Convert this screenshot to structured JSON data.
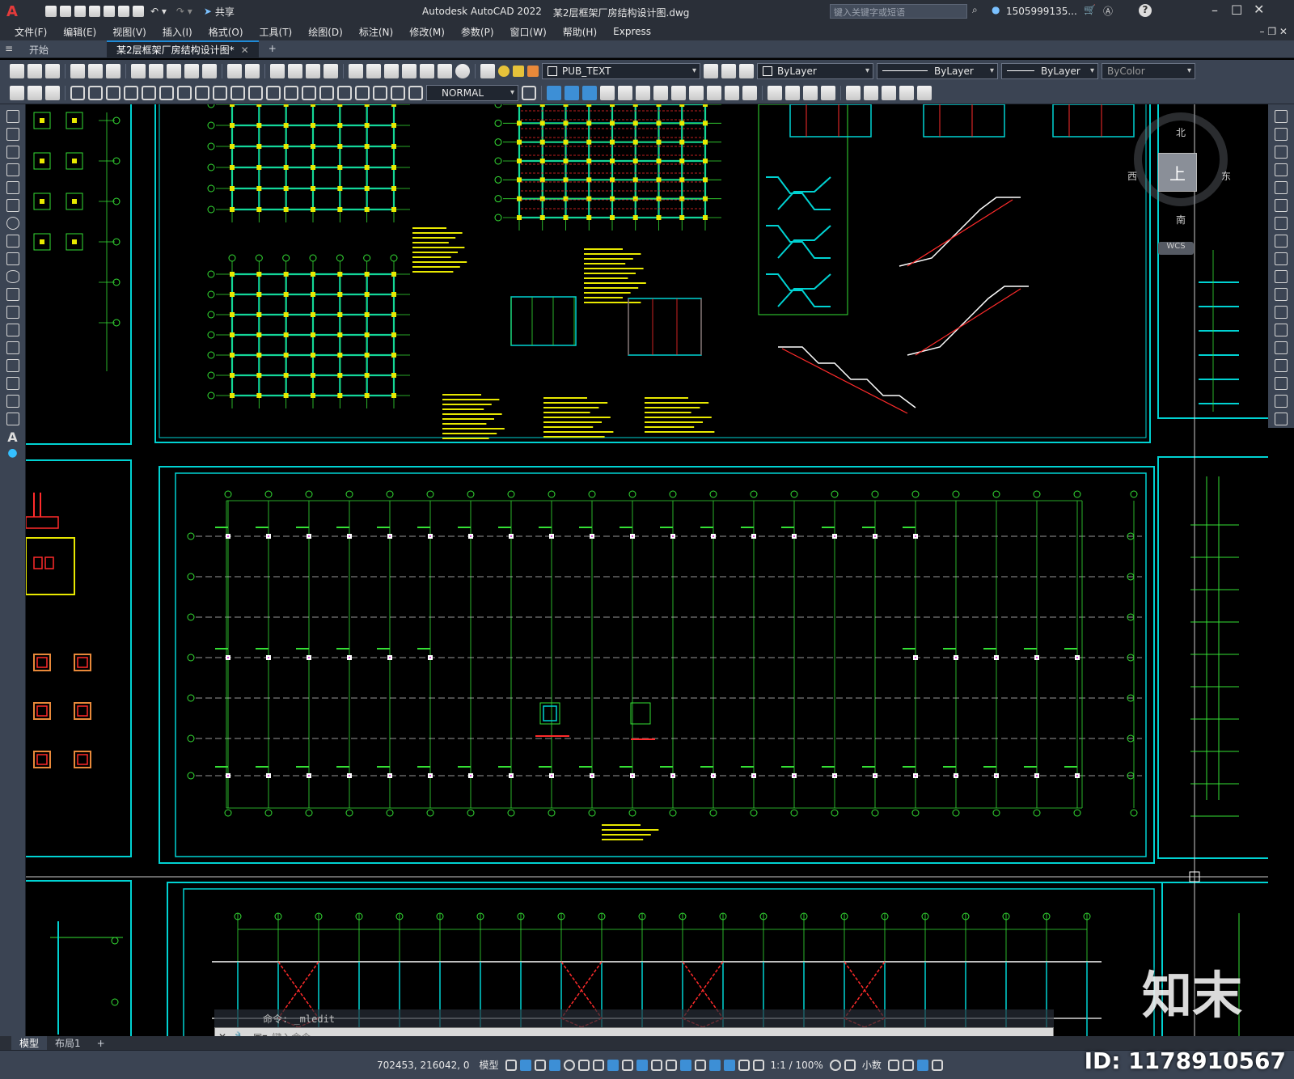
{
  "app": {
    "logo_letter": "A",
    "title": "Autodesk AutoCAD 2022",
    "filename": "某2层框架厂房结构设计图.dwg",
    "share_label": "共享",
    "search_placeholder": "键入关键字或短语",
    "user_name": "1505999135...",
    "help_label": "?"
  },
  "menu": {
    "items": [
      "文件(F)",
      "编辑(E)",
      "视图(V)",
      "插入(I)",
      "格式(O)",
      "工具(T)",
      "绘图(D)",
      "标注(N)",
      "修改(M)",
      "参数(P)",
      "窗口(W)",
      "帮助(H)",
      "Express"
    ]
  },
  "tabs": {
    "start": "开始",
    "active": "某2层框架厂房结构设计图*",
    "add": "+"
  },
  "toolbar": {
    "layer_name": "PUB_TEXT",
    "color": "ByLayer",
    "linetype": "ByLayer",
    "lineweight": "ByLayer",
    "plotstyle": "ByColor",
    "dimstyle": "NORMAL"
  },
  "viewcube": {
    "north": "北",
    "south": "南",
    "east": "东",
    "west": "西",
    "top": "上",
    "wcs": "WCS"
  },
  "command": {
    "history": "命令: _mledit",
    "placeholder": "键入命令"
  },
  "layouts": {
    "model": "模型",
    "layout1": "布局1",
    "add": "+"
  },
  "status": {
    "coords": "702453, 216042, 0",
    "model": "模型",
    "scale": "1:1 / 100%",
    "units": "小数"
  },
  "watermark": {
    "logo": "知末",
    "id": "ID: 1178910567"
  },
  "colors": {
    "cyan": "#00d2d2",
    "green": "#35e035",
    "yellow": "#e8e800",
    "red": "#ff2b2b",
    "magenta": "#e04ae0",
    "white": "#ffffff",
    "accent": "#1f8ad6"
  }
}
